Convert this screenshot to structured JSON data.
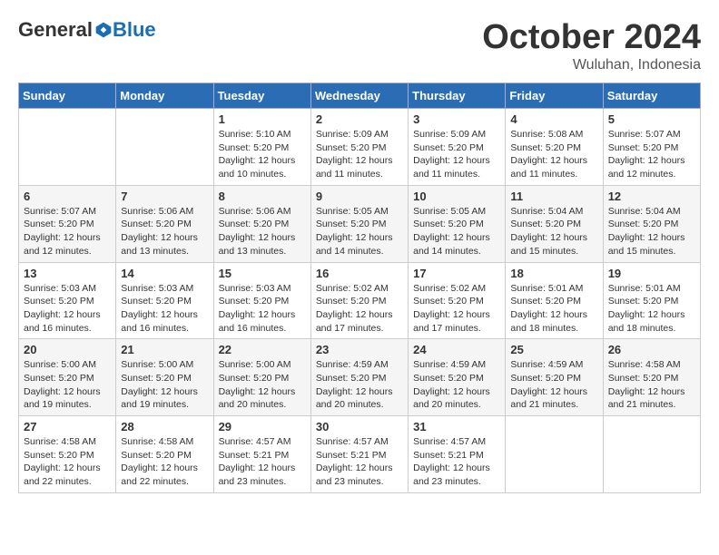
{
  "header": {
    "logo": {
      "general": "General",
      "blue": "Blue"
    },
    "title": "October 2024",
    "location": "Wuluhan, Indonesia"
  },
  "calendar": {
    "headers": [
      "Sunday",
      "Monday",
      "Tuesday",
      "Wednesday",
      "Thursday",
      "Friday",
      "Saturday"
    ],
    "weeks": [
      [
        {
          "day": "",
          "sunrise": "",
          "sunset": "",
          "daylight": ""
        },
        {
          "day": "",
          "sunrise": "",
          "sunset": "",
          "daylight": ""
        },
        {
          "day": "1",
          "sunrise": "Sunrise: 5:10 AM",
          "sunset": "Sunset: 5:20 PM",
          "daylight": "Daylight: 12 hours and 10 minutes."
        },
        {
          "day": "2",
          "sunrise": "Sunrise: 5:09 AM",
          "sunset": "Sunset: 5:20 PM",
          "daylight": "Daylight: 12 hours and 11 minutes."
        },
        {
          "day": "3",
          "sunrise": "Sunrise: 5:09 AM",
          "sunset": "Sunset: 5:20 PM",
          "daylight": "Daylight: 12 hours and 11 minutes."
        },
        {
          "day": "4",
          "sunrise": "Sunrise: 5:08 AM",
          "sunset": "Sunset: 5:20 PM",
          "daylight": "Daylight: 12 hours and 11 minutes."
        },
        {
          "day": "5",
          "sunrise": "Sunrise: 5:07 AM",
          "sunset": "Sunset: 5:20 PM",
          "daylight": "Daylight: 12 hours and 12 minutes."
        }
      ],
      [
        {
          "day": "6",
          "sunrise": "Sunrise: 5:07 AM",
          "sunset": "Sunset: 5:20 PM",
          "daylight": "Daylight: 12 hours and 12 minutes."
        },
        {
          "day": "7",
          "sunrise": "Sunrise: 5:06 AM",
          "sunset": "Sunset: 5:20 PM",
          "daylight": "Daylight: 12 hours and 13 minutes."
        },
        {
          "day": "8",
          "sunrise": "Sunrise: 5:06 AM",
          "sunset": "Sunset: 5:20 PM",
          "daylight": "Daylight: 12 hours and 13 minutes."
        },
        {
          "day": "9",
          "sunrise": "Sunrise: 5:05 AM",
          "sunset": "Sunset: 5:20 PM",
          "daylight": "Daylight: 12 hours and 14 minutes."
        },
        {
          "day": "10",
          "sunrise": "Sunrise: 5:05 AM",
          "sunset": "Sunset: 5:20 PM",
          "daylight": "Daylight: 12 hours and 14 minutes."
        },
        {
          "day": "11",
          "sunrise": "Sunrise: 5:04 AM",
          "sunset": "Sunset: 5:20 PM",
          "daylight": "Daylight: 12 hours and 15 minutes."
        },
        {
          "day": "12",
          "sunrise": "Sunrise: 5:04 AM",
          "sunset": "Sunset: 5:20 PM",
          "daylight": "Daylight: 12 hours and 15 minutes."
        }
      ],
      [
        {
          "day": "13",
          "sunrise": "Sunrise: 5:03 AM",
          "sunset": "Sunset: 5:20 PM",
          "daylight": "Daylight: 12 hours and 16 minutes."
        },
        {
          "day": "14",
          "sunrise": "Sunrise: 5:03 AM",
          "sunset": "Sunset: 5:20 PM",
          "daylight": "Daylight: 12 hours and 16 minutes."
        },
        {
          "day": "15",
          "sunrise": "Sunrise: 5:03 AM",
          "sunset": "Sunset: 5:20 PM",
          "daylight": "Daylight: 12 hours and 16 minutes."
        },
        {
          "day": "16",
          "sunrise": "Sunrise: 5:02 AM",
          "sunset": "Sunset: 5:20 PM",
          "daylight": "Daylight: 12 hours and 17 minutes."
        },
        {
          "day": "17",
          "sunrise": "Sunrise: 5:02 AM",
          "sunset": "Sunset: 5:20 PM",
          "daylight": "Daylight: 12 hours and 17 minutes."
        },
        {
          "day": "18",
          "sunrise": "Sunrise: 5:01 AM",
          "sunset": "Sunset: 5:20 PM",
          "daylight": "Daylight: 12 hours and 18 minutes."
        },
        {
          "day": "19",
          "sunrise": "Sunrise: 5:01 AM",
          "sunset": "Sunset: 5:20 PM",
          "daylight": "Daylight: 12 hours and 18 minutes."
        }
      ],
      [
        {
          "day": "20",
          "sunrise": "Sunrise: 5:00 AM",
          "sunset": "Sunset: 5:20 PM",
          "daylight": "Daylight: 12 hours and 19 minutes."
        },
        {
          "day": "21",
          "sunrise": "Sunrise: 5:00 AM",
          "sunset": "Sunset: 5:20 PM",
          "daylight": "Daylight: 12 hours and 19 minutes."
        },
        {
          "day": "22",
          "sunrise": "Sunrise: 5:00 AM",
          "sunset": "Sunset: 5:20 PM",
          "daylight": "Daylight: 12 hours and 20 minutes."
        },
        {
          "day": "23",
          "sunrise": "Sunrise: 4:59 AM",
          "sunset": "Sunset: 5:20 PM",
          "daylight": "Daylight: 12 hours and 20 minutes."
        },
        {
          "day": "24",
          "sunrise": "Sunrise: 4:59 AM",
          "sunset": "Sunset: 5:20 PM",
          "daylight": "Daylight: 12 hours and 20 minutes."
        },
        {
          "day": "25",
          "sunrise": "Sunrise: 4:59 AM",
          "sunset": "Sunset: 5:20 PM",
          "daylight": "Daylight: 12 hours and 21 minutes."
        },
        {
          "day": "26",
          "sunrise": "Sunrise: 4:58 AM",
          "sunset": "Sunset: 5:20 PM",
          "daylight": "Daylight: 12 hours and 21 minutes."
        }
      ],
      [
        {
          "day": "27",
          "sunrise": "Sunrise: 4:58 AM",
          "sunset": "Sunset: 5:20 PM",
          "daylight": "Daylight: 12 hours and 22 minutes."
        },
        {
          "day": "28",
          "sunrise": "Sunrise: 4:58 AM",
          "sunset": "Sunset: 5:20 PM",
          "daylight": "Daylight: 12 hours and 22 minutes."
        },
        {
          "day": "29",
          "sunrise": "Sunrise: 4:57 AM",
          "sunset": "Sunset: 5:21 PM",
          "daylight": "Daylight: 12 hours and 23 minutes."
        },
        {
          "day": "30",
          "sunrise": "Sunrise: 4:57 AM",
          "sunset": "Sunset: 5:21 PM",
          "daylight": "Daylight: 12 hours and 23 minutes."
        },
        {
          "day": "31",
          "sunrise": "Sunrise: 4:57 AM",
          "sunset": "Sunset: 5:21 PM",
          "daylight": "Daylight: 12 hours and 23 minutes."
        },
        {
          "day": "",
          "sunrise": "",
          "sunset": "",
          "daylight": ""
        },
        {
          "day": "",
          "sunrise": "",
          "sunset": "",
          "daylight": ""
        }
      ]
    ]
  }
}
